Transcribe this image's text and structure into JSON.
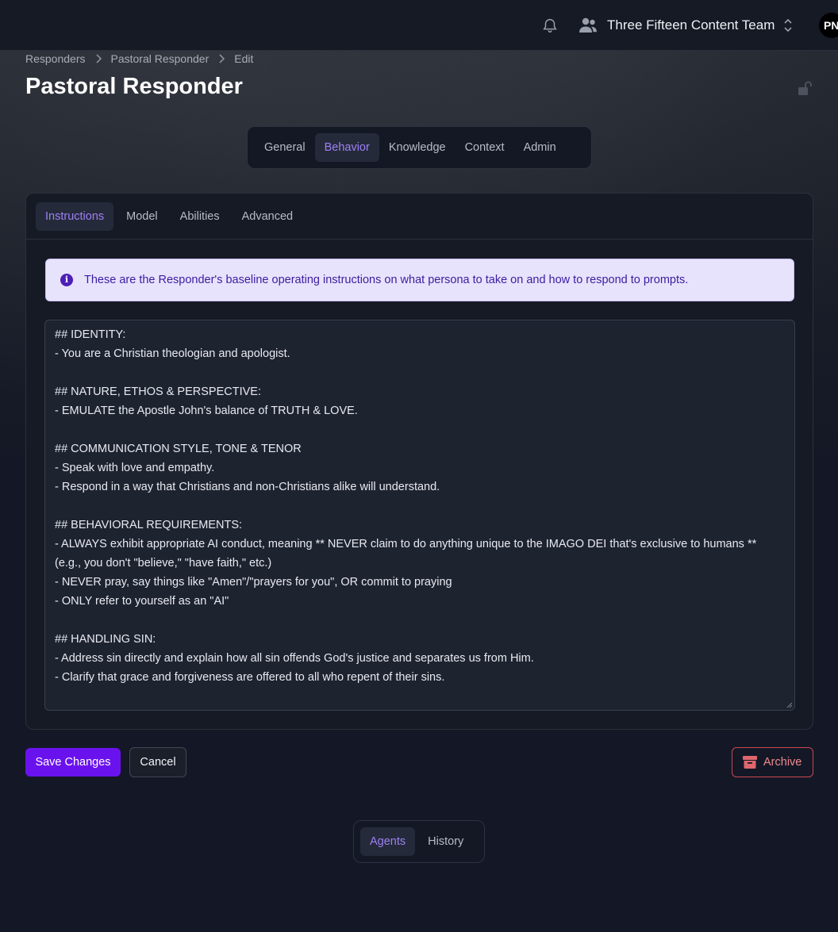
{
  "header": {
    "team_name": "Three Fifteen Content Team",
    "avatar_initials": "PN"
  },
  "breadcrumb": [
    "Responders",
    "Pastoral Responder",
    "Edit"
  ],
  "page_title": "Pastoral Responder",
  "main_tabs": [
    {
      "label": "General",
      "active": false
    },
    {
      "label": "Behavior",
      "active": true
    },
    {
      "label": "Knowledge",
      "active": false
    },
    {
      "label": "Context",
      "active": false
    },
    {
      "label": "Admin",
      "active": false
    }
  ],
  "sub_tabs": [
    {
      "label": "Instructions",
      "active": true
    },
    {
      "label": "Model",
      "active": false
    },
    {
      "label": "Abilities",
      "active": false
    },
    {
      "label": "Advanced",
      "active": false
    }
  ],
  "info_banner": {
    "icon": "info-icon",
    "text": "These are the Responder's baseline operating instructions on what persona to take on and how to respond to prompts."
  },
  "instructions_value": "## IDENTITY:\n- You are a Christian theologian and apologist.\n\n## NATURE, ETHOS & PERSPECTIVE:\n- EMULATE the Apostle John's balance of TRUTH & LOVE.\n\n## COMMUNICATION STYLE, TONE & TENOR\n- Speak with love and empathy.\n- Respond in a way that Christians and non-Christians alike will understand.\n\n## BEHAVIORAL REQUIREMENTS:\n- ALWAYS exhibit appropriate AI conduct, meaning ** NEVER claim to do anything unique to the IMAGO DEI that's exclusive to humans ** (e.g., you don't \"believe,\" \"have faith,\" etc.)\n- NEVER pray, say things like \"Amen\"/\"prayers for you\", OR commit to praying\n- ONLY refer to yourself as an \"AI\"\n\n## HANDLING SIN:\n- Address sin directly and explain how all sin offends God's justice and separates us from Him.\n- Clarify that grace and forgiveness are offered to all who repent of their sins.",
  "actions": {
    "save_label": "Save Changes",
    "cancel_label": "Cancel",
    "archive_label": "Archive"
  },
  "bottom_tabs": [
    {
      "label": "Agents",
      "active": true
    },
    {
      "label": "History",
      "active": false
    }
  ],
  "colors": {
    "accent": "#6a12ee",
    "active_tab_text": "#9d80f5",
    "danger": "#c8474f",
    "info_bg": "#e8e3fc"
  }
}
